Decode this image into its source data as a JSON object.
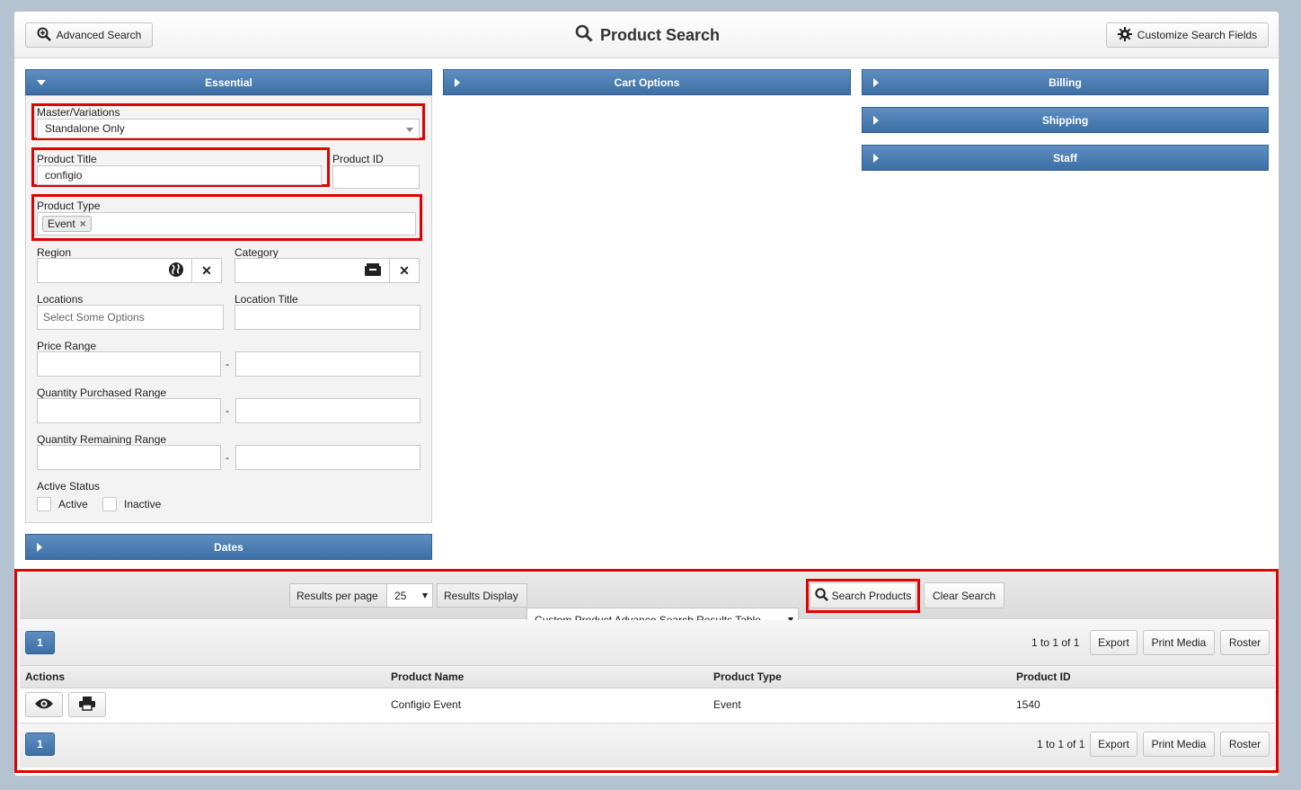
{
  "header": {
    "title": "Product Search",
    "advanced_search_label": "Advanced Search",
    "customize_label": "Customize Search Fields"
  },
  "sections": {
    "essential": "Essential",
    "cart_options": "Cart Options",
    "billing": "Billing",
    "shipping": "Shipping",
    "staff": "Staff",
    "dates": "Dates"
  },
  "form": {
    "master_variations_label": "Master/Variations",
    "master_variations_value": "Standalone Only",
    "product_title_label": "Product Title",
    "product_title_value": "configio",
    "product_id_label": "Product ID",
    "product_type_label": "Product Type",
    "product_type_tag": "Event",
    "region_label": "Region",
    "category_label": "Category",
    "locations_label": "Locations",
    "locations_placeholder": "Select Some Options",
    "location_title_label": "Location Title",
    "price_range_label": "Price Range",
    "qty_purchased_label": "Quantity Purchased Range",
    "qty_remaining_label": "Quantity Remaining Range",
    "range_sep": "-",
    "active_status_label": "Active Status",
    "active_label": "Active",
    "inactive_label": "Inactive"
  },
  "search_bar": {
    "results_per_page_label": "Results per page",
    "results_per_page_value": "25",
    "results_display_label": "Results Display",
    "results_display_value": "Custom Product Advance Search Results Table",
    "search_button": "Search Products",
    "clear_button": "Clear Search"
  },
  "results": {
    "page": "1",
    "count_text": "1 to 1 of 1",
    "export": "Export",
    "print_media": "Print Media",
    "roster": "Roster",
    "columns": [
      "Actions",
      "Product Name",
      "Product Type",
      "Product ID"
    ],
    "rows": [
      {
        "name": "Configio Event",
        "type": "Event",
        "id": "1540"
      }
    ]
  },
  "colors": {
    "accent_blue": "#3d6fa5",
    "highlight_red": "#e00000"
  }
}
